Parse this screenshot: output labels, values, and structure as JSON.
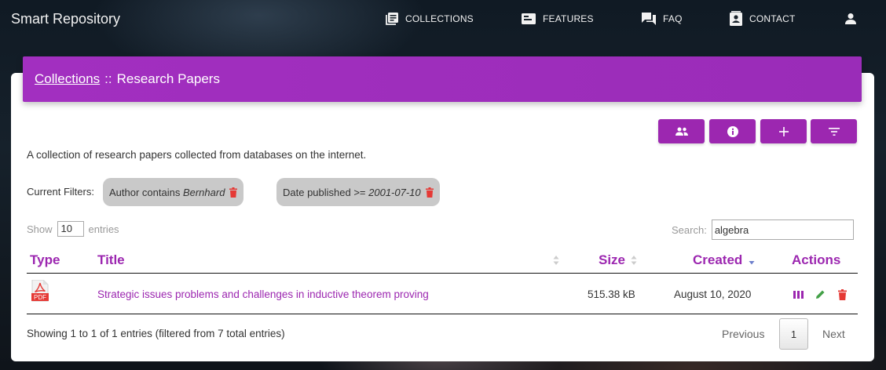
{
  "navbar": {
    "brand": "Smart Repository",
    "items": [
      {
        "label": "COLLECTIONS",
        "icon": "collections-icon"
      },
      {
        "label": "FEATURES",
        "icon": "features-icon"
      },
      {
        "label": "FAQ",
        "icon": "faq-icon"
      },
      {
        "label": "CONTACT",
        "icon": "contact-icon"
      }
    ],
    "account_icon": "account-icon"
  },
  "header": {
    "breadcrumb_link": "Collections",
    "separator": "::",
    "current": "Research Papers"
  },
  "toolbar": {
    "buttons": [
      "people-icon",
      "info-icon",
      "plus-icon",
      "filter-icon"
    ]
  },
  "description": "A collection of research papers collected from databases on the internet.",
  "filters": {
    "label": "Current Filters:",
    "chips": [
      {
        "prefix": "Author contains ",
        "value": "Bernhard"
      },
      {
        "prefix": "Date published >= ",
        "value": "2001-07-10"
      }
    ]
  },
  "length": {
    "show_label": "Show",
    "value": "10",
    "entries_label": "entries"
  },
  "search": {
    "label": "Search:",
    "value": "algebra"
  },
  "table": {
    "columns": [
      "Type",
      "Title",
      "Size",
      "Created",
      "Actions"
    ],
    "rows": [
      {
        "type_badge": "PDF",
        "title": "Strategic issues problems and challenges in inductive theorem proving",
        "size": "515.38 kB",
        "created": "August 10, 2020"
      }
    ]
  },
  "footer": {
    "info": "Showing 1 to 1 of 1 entries (filtered from 7 total entries)",
    "previous": "Previous",
    "current_page": "1",
    "next": "Next"
  },
  "colors": {
    "accent": "#9c27b0",
    "edit": "#43a047",
    "delete": "#e53935"
  }
}
